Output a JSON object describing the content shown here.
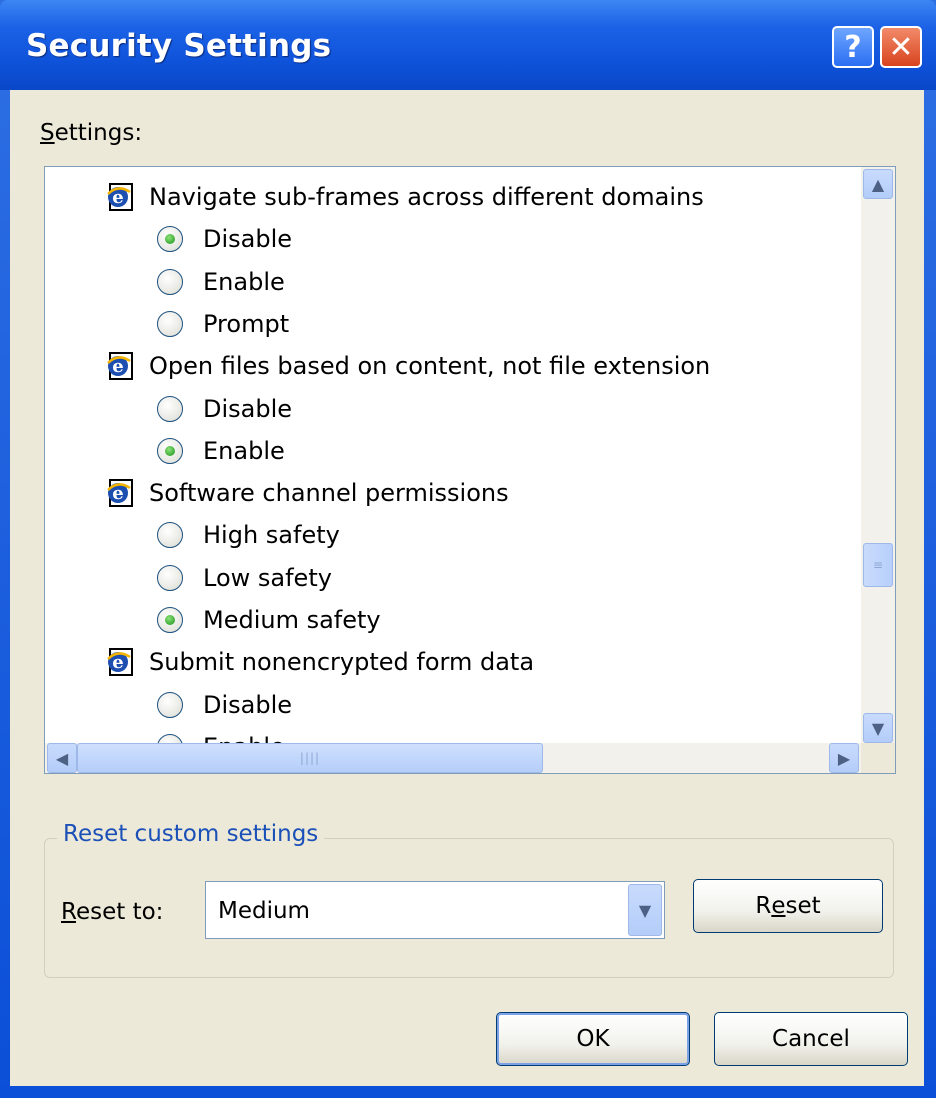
{
  "window": {
    "title": "Security Settings"
  },
  "titlebar_buttons": {
    "help": "?",
    "close": "✕"
  },
  "settings_label_prefix": "S",
  "settings_label_rest": "ettings:",
  "tree": {
    "items": [
      {
        "type": "group",
        "label": "Navigate sub-frames across different domains",
        "icon": "ie-icon"
      },
      {
        "type": "option",
        "label": "Disable",
        "checked": true
      },
      {
        "type": "option",
        "label": "Enable",
        "checked": false
      },
      {
        "type": "option",
        "label": "Prompt",
        "checked": false
      },
      {
        "type": "group",
        "label": "Open files based on content, not file extension",
        "icon": "ie-icon"
      },
      {
        "type": "option",
        "label": "Disable",
        "checked": false
      },
      {
        "type": "option",
        "label": "Enable",
        "checked": true
      },
      {
        "type": "group",
        "label": "Software channel permissions",
        "icon": "ie-icon"
      },
      {
        "type": "option",
        "label": "High safety",
        "checked": false
      },
      {
        "type": "option",
        "label": "Low safety",
        "checked": false
      },
      {
        "type": "option",
        "label": "Medium safety",
        "checked": true
      },
      {
        "type": "group",
        "label": "Submit nonencrypted form data",
        "icon": "ie-icon"
      },
      {
        "type": "option",
        "label": "Disable",
        "checked": false
      },
      {
        "type": "option",
        "label": "Enable",
        "checked": false
      }
    ]
  },
  "reset_section": {
    "title": "Reset custom settings",
    "reset_to_prefix": "R",
    "reset_to_rest": "eset to:",
    "selected": "Medium",
    "reset_button_prefix": "R",
    "reset_button_ul": "e",
    "reset_button_rest": "set"
  },
  "buttons": {
    "ok": "OK",
    "cancel": "Cancel"
  }
}
